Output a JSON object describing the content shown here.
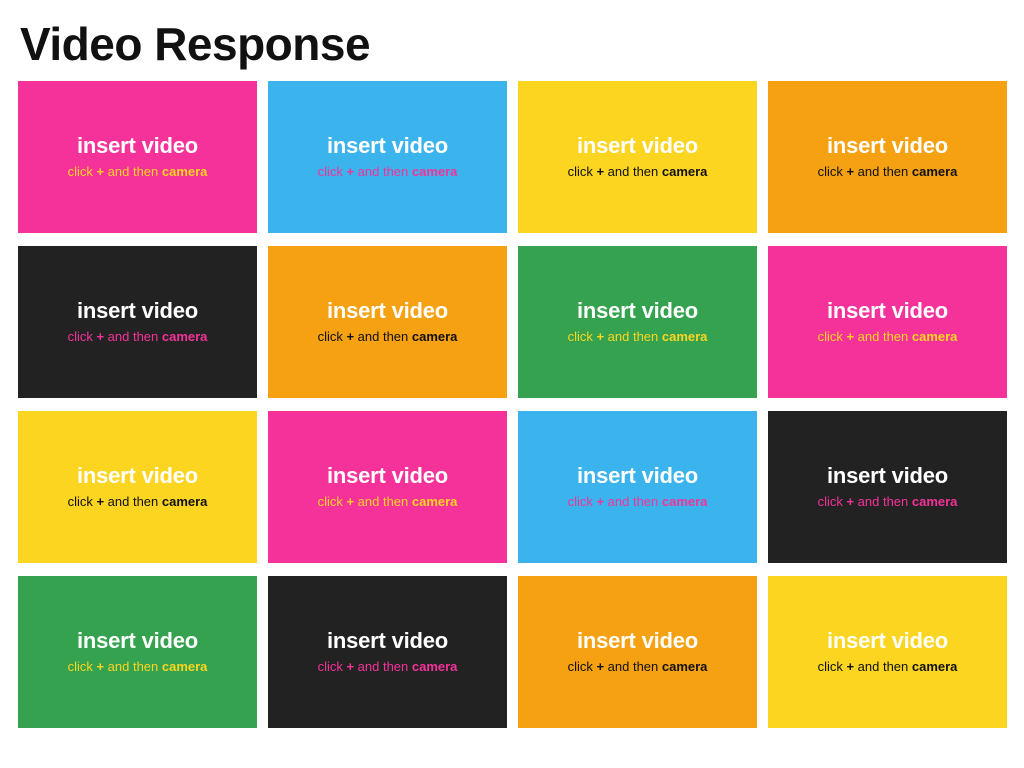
{
  "header": {
    "title": "Video Response"
  },
  "card_defaults": {
    "title": "insert video",
    "subtitle_prefix": "click ",
    "subtitle_plus": "+",
    "subtitle_middle": " and then ",
    "subtitle_emphasis": "camera"
  },
  "palette": {
    "pink": "#F5329A",
    "blue": "#3BB3EC",
    "yellow": "#FCD521",
    "orange": "#F5A111",
    "green": "#34A24E",
    "dark": "#222222",
    "white": "#FFFFFF",
    "black": "#111111",
    "page_background": "#FFFFFF"
  },
  "cards": [
    {
      "index": 1,
      "background": "#F5329A",
      "title": "insert video",
      "title_color": "#FFFFFF",
      "subtitle_prefix": "click ",
      "subtitle_plus": "+",
      "subtitle_middle": " and then ",
      "subtitle_emphasis": "camera",
      "subtitle_color": "#FCD521"
    },
    {
      "index": 2,
      "background": "#3BB3EC",
      "title": "insert video",
      "title_color": "#FFFFFF",
      "subtitle_prefix": "click ",
      "subtitle_plus": "+",
      "subtitle_middle": " and then ",
      "subtitle_emphasis": "camera",
      "subtitle_color": "#F5329A"
    },
    {
      "index": 3,
      "background": "#FCD521",
      "title": "insert video",
      "title_color": "#FFFFFF",
      "subtitle_prefix": "click ",
      "subtitle_plus": "+",
      "subtitle_middle": " and then ",
      "subtitle_emphasis": "camera",
      "subtitle_color": "#111111"
    },
    {
      "index": 4,
      "background": "#F5A111",
      "title": "insert video",
      "title_color": "#FFFFFF",
      "subtitle_prefix": "click ",
      "subtitle_plus": "+",
      "subtitle_middle": " and then ",
      "subtitle_emphasis": "camera",
      "subtitle_color": "#111111"
    },
    {
      "index": 5,
      "background": "#222222",
      "title": "insert video",
      "title_color": "#FFFFFF",
      "subtitle_prefix": "click ",
      "subtitle_plus": "+",
      "subtitle_middle": " and then ",
      "subtitle_emphasis": "camera",
      "subtitle_color": "#F5329A"
    },
    {
      "index": 6,
      "background": "#F5A111",
      "title": "insert video",
      "title_color": "#FFFFFF",
      "subtitle_prefix": "click ",
      "subtitle_plus": "+",
      "subtitle_middle": " and then ",
      "subtitle_emphasis": "camera",
      "subtitle_color": "#111111"
    },
    {
      "index": 7,
      "background": "#34A24E",
      "title": "insert video",
      "title_color": "#FFFFFF",
      "subtitle_prefix": "click ",
      "subtitle_plus": "+",
      "subtitle_middle": " and then ",
      "subtitle_emphasis": "camera",
      "subtitle_color": "#FCD521"
    },
    {
      "index": 8,
      "background": "#F5329A",
      "title": "insert video",
      "title_color": "#FFFFFF",
      "subtitle_prefix": "click ",
      "subtitle_plus": "+",
      "subtitle_middle": " and then ",
      "subtitle_emphasis": "camera",
      "subtitle_color": "#FCD521"
    },
    {
      "index": 9,
      "background": "#FCD521",
      "title": "insert video",
      "title_color": "#FFFFFF",
      "subtitle_prefix": "click ",
      "subtitle_plus": "+",
      "subtitle_middle": " and then ",
      "subtitle_emphasis": "camera",
      "subtitle_color": "#111111"
    },
    {
      "index": 10,
      "background": "#F5329A",
      "title": "insert video",
      "title_color": "#FFFFFF",
      "subtitle_prefix": "click ",
      "subtitle_plus": "+",
      "subtitle_middle": " and then ",
      "subtitle_emphasis": "camera",
      "subtitle_color": "#FCD521"
    },
    {
      "index": 11,
      "background": "#3BB3EC",
      "title": "insert video",
      "title_color": "#FFFFFF",
      "subtitle_prefix": "click ",
      "subtitle_plus": "+",
      "subtitle_middle": " and then ",
      "subtitle_emphasis": "camera",
      "subtitle_color": "#F5329A"
    },
    {
      "index": 12,
      "background": "#222222",
      "title": "insert video",
      "title_color": "#FFFFFF",
      "subtitle_prefix": "click ",
      "subtitle_plus": "+",
      "subtitle_middle": " and then ",
      "subtitle_emphasis": "camera",
      "subtitle_color": "#F5329A"
    },
    {
      "index": 13,
      "background": "#34A24E",
      "title": "insert video",
      "title_color": "#FFFFFF",
      "subtitle_prefix": "click ",
      "subtitle_plus": "+",
      "subtitle_middle": " and then ",
      "subtitle_emphasis": "camera",
      "subtitle_color": "#FCD521"
    },
    {
      "index": 14,
      "background": "#222222",
      "title": "insert video",
      "title_color": "#FFFFFF",
      "subtitle_prefix": "click ",
      "subtitle_plus": "+",
      "subtitle_middle": " and then ",
      "subtitle_emphasis": "camera",
      "subtitle_color": "#F5329A"
    },
    {
      "index": 15,
      "background": "#F5A111",
      "title": "insert video",
      "title_color": "#FFFFFF",
      "subtitle_prefix": "click ",
      "subtitle_plus": "+",
      "subtitle_middle": " and then ",
      "subtitle_emphasis": "camera",
      "subtitle_color": "#111111"
    },
    {
      "index": 16,
      "background": "#FCD521",
      "title": "insert video",
      "title_color": "#FFFFFF",
      "subtitle_prefix": "click ",
      "subtitle_plus": "+",
      "subtitle_middle": " and then ",
      "subtitle_emphasis": "camera",
      "subtitle_color": "#111111"
    }
  ]
}
